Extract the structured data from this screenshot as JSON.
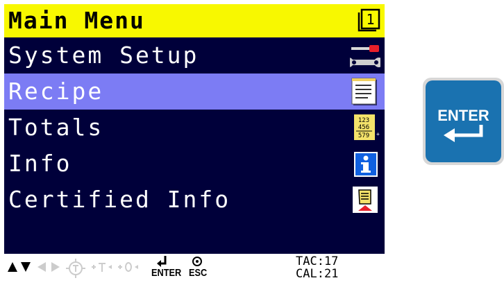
{
  "title": "Main Menu",
  "page_number": "1",
  "menu": {
    "items": [
      {
        "label": "System Setup",
        "icon": "wrench-screwdriver-icon",
        "selected": false
      },
      {
        "label": "Recipe",
        "icon": "notepad-icon",
        "selected": true
      },
      {
        "label": "Totals",
        "icon": "totals-icon",
        "selected": false
      },
      {
        "label": "Info",
        "icon": "info-icon",
        "selected": false
      },
      {
        "label": "Certified Info",
        "icon": "certified-info-icon",
        "selected": false
      }
    ]
  },
  "totals_icon_text": [
    "123",
    "456",
    "579"
  ],
  "status": {
    "enter_label": "ENTER",
    "esc_label": "ESC",
    "tac": "TAC:17",
    "cal": "CAL:21"
  },
  "enter_button": {
    "label": "ENTER"
  },
  "colors": {
    "title_bg": "#f8f800",
    "menu_bg": "#00003a",
    "selected_bg": "#7c7cf4",
    "enter_button": "#1a72b0"
  }
}
